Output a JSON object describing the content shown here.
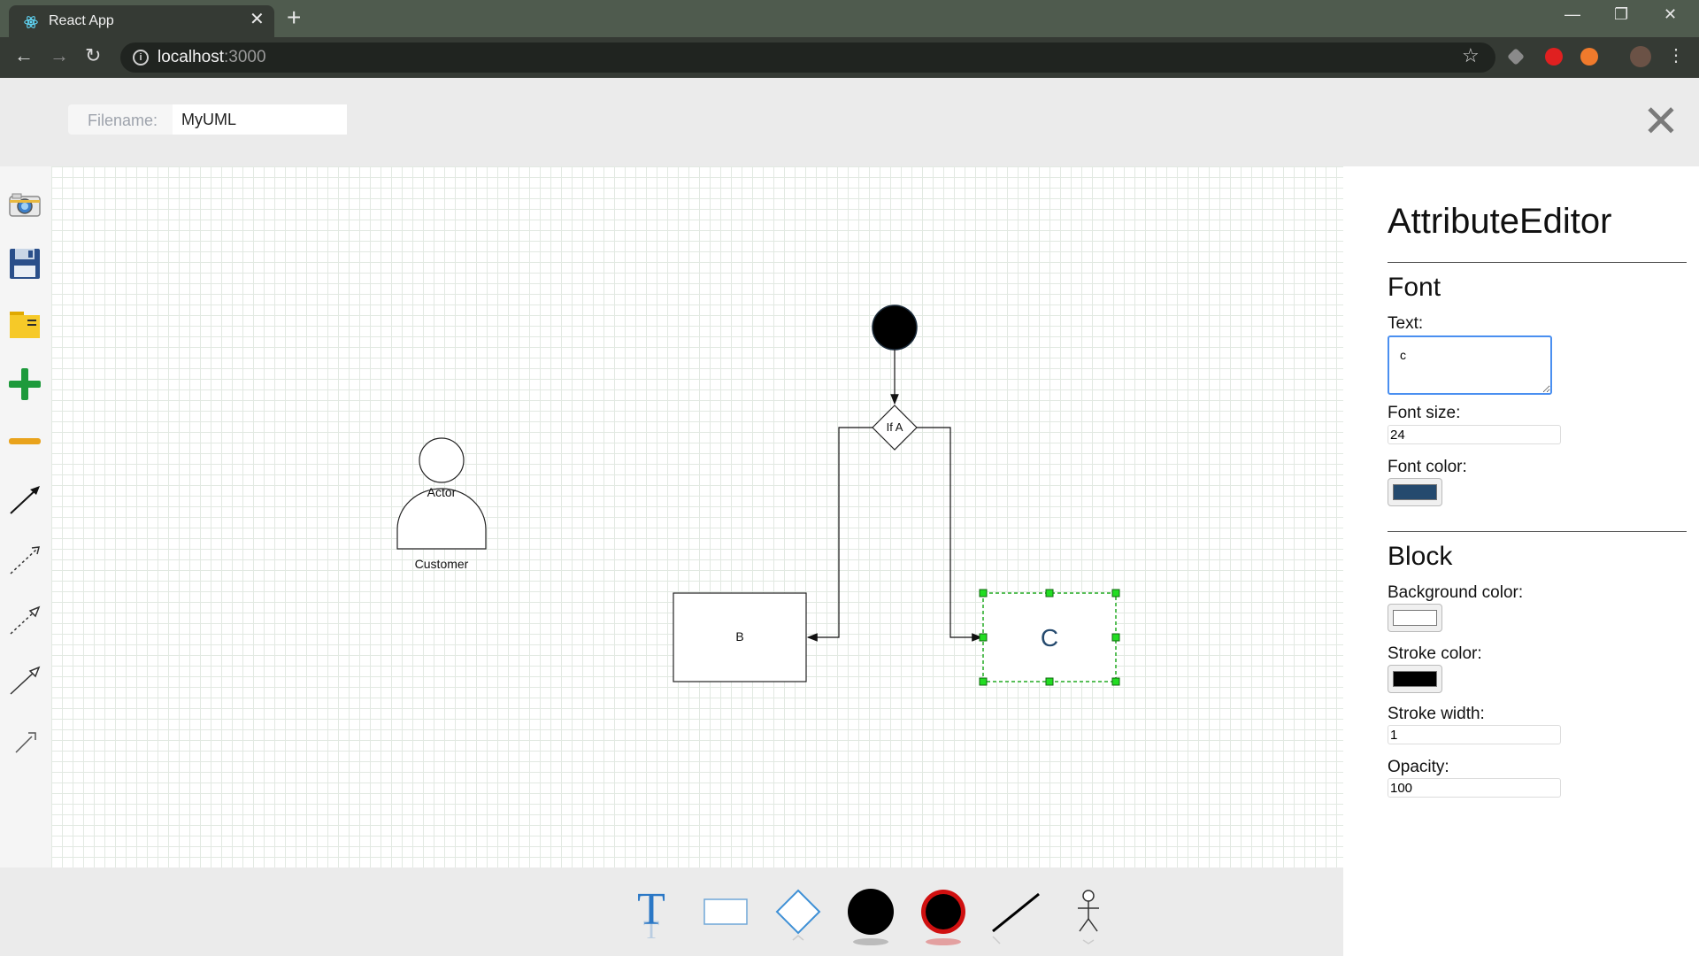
{
  "browser": {
    "tab_title": "React App",
    "url_host": "localhost",
    "url_port": ":3000"
  },
  "header": {
    "filename_label": "Filename:",
    "filename_value": "MyUML"
  },
  "diagram": {
    "actor_label": "Actor",
    "actor_name": "Customer",
    "decision_label": "If A",
    "block_b_label": "B",
    "block_c_label": "C"
  },
  "attribute_editor": {
    "title": "AttributeEditor",
    "font_section": "Font",
    "text_label": "Text:",
    "text_value": "c",
    "font_size_label": "Font size:",
    "font_size_value": "24",
    "font_color_label": "Font color:",
    "font_color": "#254a6e",
    "block_section": "Block",
    "background_color_label": "Background color:",
    "background_color": "#ffffff",
    "stroke_color_label": "Stroke color:",
    "stroke_color": "#000000",
    "stroke_width_label": "Stroke width:",
    "stroke_width_value": "1",
    "opacity_label": "Opacity:",
    "opacity_value": "100"
  },
  "icons": {
    "left_toolbar": [
      "camera-icon",
      "save-icon",
      "folder-icon",
      "zoom-in-icon",
      "zoom-out-icon",
      "arrow-solid-icon",
      "arrow-dashed-icon",
      "arrow-dashed-open-icon",
      "arrow-open-icon",
      "arrow-short-icon"
    ],
    "palette": [
      "text-tool-icon",
      "rectangle-tool-icon",
      "diamond-tool-icon",
      "initial-node-tool-icon",
      "final-node-tool-icon",
      "line-tool-icon",
      "actor-tool-icon"
    ]
  },
  "colors": {
    "selection": "#22aa22",
    "accent_blue": "#2b78c6"
  }
}
